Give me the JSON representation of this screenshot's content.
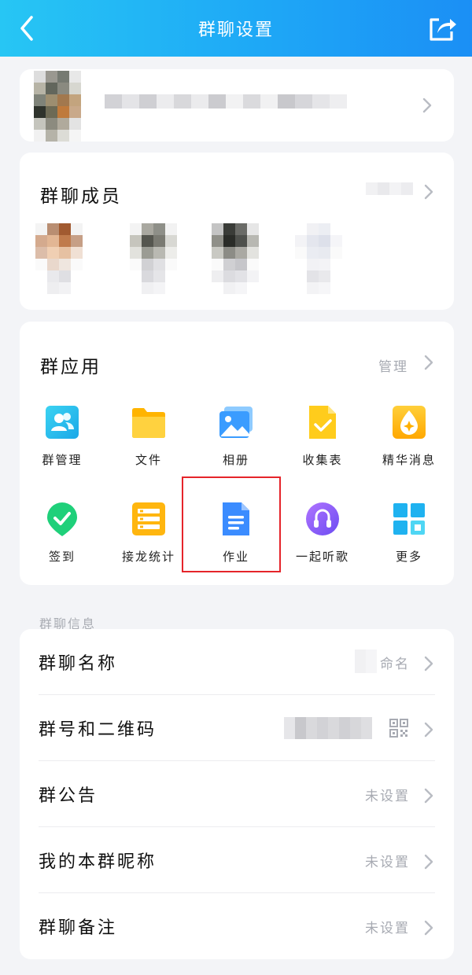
{
  "header": {
    "title": "群聊设置"
  },
  "members": {
    "title": "群聊成员"
  },
  "apps": {
    "title": "群应用",
    "manage_label": "管理",
    "items": [
      {
        "label": "群管理",
        "icon": "group-manage-icon"
      },
      {
        "label": "文件",
        "icon": "folder-icon"
      },
      {
        "label": "相册",
        "icon": "photo-album-icon"
      },
      {
        "label": "收集表",
        "icon": "collect-form-icon"
      },
      {
        "label": "精华消息",
        "icon": "essence-message-icon"
      },
      {
        "label": "签到",
        "icon": "check-in-icon"
      },
      {
        "label": "接龙统计",
        "icon": "relay-stats-icon"
      },
      {
        "label": "作业",
        "icon": "homework-icon"
      },
      {
        "label": "一起听歌",
        "icon": "listen-together-icon"
      },
      {
        "label": "更多",
        "icon": "more-grid-icon"
      }
    ]
  },
  "info": {
    "section_label": "群聊信息",
    "rows": [
      {
        "label": "群聊名称",
        "value": "命名"
      },
      {
        "label": "群号和二维码",
        "value": ""
      },
      {
        "label": "群公告",
        "value": "未设置"
      },
      {
        "label": "我的本群昵称",
        "value": "未设置"
      },
      {
        "label": "群聊备注",
        "value": "未设置"
      }
    ]
  },
  "colors": {
    "header_start": "#27c6f4",
    "header_end": "#1b8ff5",
    "highlight_border": "#e5242a"
  }
}
